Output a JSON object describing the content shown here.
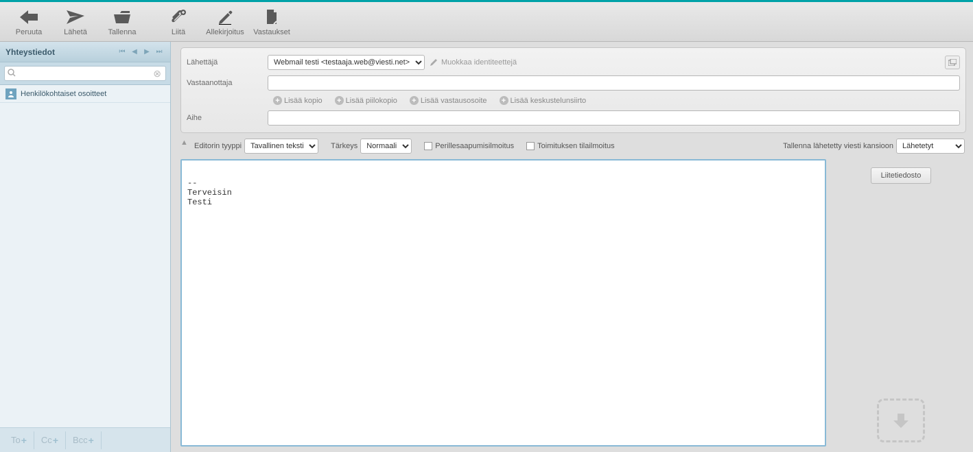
{
  "toolbar": {
    "cancel": "Peruuta",
    "send": "Lähetä",
    "save": "Tallenna",
    "attach": "Liitä",
    "signature": "Allekirjoitus",
    "responses": "Vastaukset"
  },
  "sidebar": {
    "title": "Yhteystiedot",
    "search_placeholder": "",
    "item0": "Henkilökohtaiset osoitteet",
    "footer_to": "To",
    "footer_cc": "Cc",
    "footer_bcc": "Bcc"
  },
  "compose": {
    "from_label": "Lähettäjä",
    "from_value": "Webmail testi <testaaja.web@viesti.net>",
    "edit_identities": "Muokkaa identiteettejä",
    "to_label": "Vastaanottaja",
    "to_value": "",
    "add_cc": "Lisää kopio",
    "add_bcc": "Lisää piilokopio",
    "add_replyto": "Lisää vastausosoite",
    "add_followup": "Lisää keskustelunsiirto",
    "subject_label": "Aihe",
    "subject_value": ""
  },
  "options": {
    "editor_type_label": "Editorin tyyppi",
    "editor_type_value": "Tavallinen teksti",
    "priority_label": "Tärkeys",
    "priority_value": "Normaali",
    "return_receipt": "Perillesaapumisilmoitus",
    "dsn": "Toimituksen tilailmoitus",
    "save_sent_label": "Tallenna lähetetty viesti kansioon",
    "save_sent_value": "Lähetetyt"
  },
  "editor": {
    "body": "\n-- \nTerveisin\nTesti"
  },
  "attach": {
    "button": "Liitetiedosto"
  }
}
